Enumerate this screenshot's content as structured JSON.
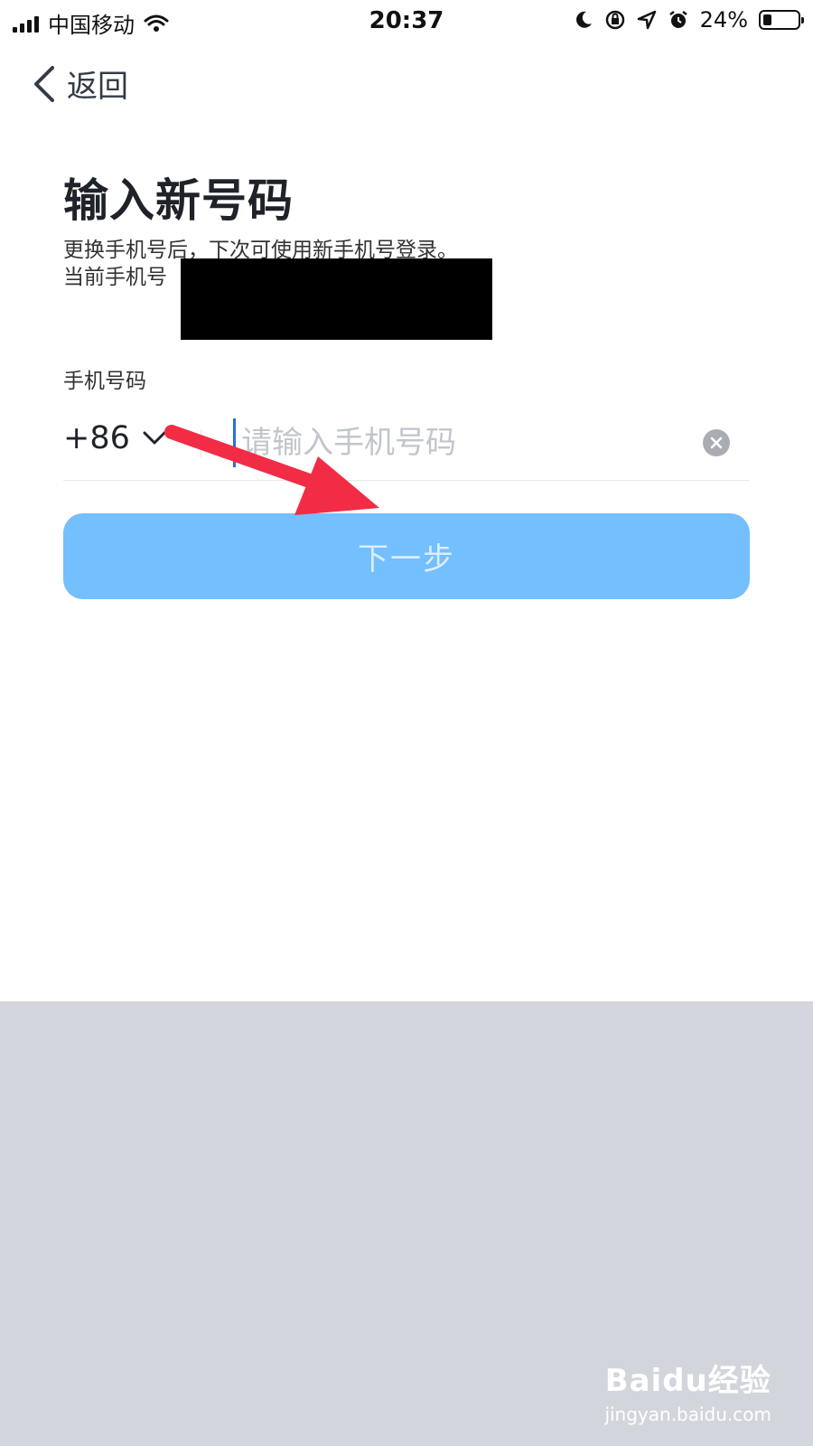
{
  "status_bar": {
    "carrier": "中国移动",
    "time": "20:37",
    "battery_percent": "24%",
    "battery_level": 0.24
  },
  "nav": {
    "back_label": "返回"
  },
  "page": {
    "title": "输入新号码",
    "description_line1": "更换手机号后，下次可使用新手机号登录。",
    "description_line2": "当前手机号"
  },
  "form": {
    "field_label": "手机号码",
    "country_code": "+86",
    "phone_value": "",
    "phone_placeholder": "请输入手机号码",
    "next_button": "下一步"
  },
  "watermark": {
    "brand": "Baidu经验",
    "url": "jingyan.baidu.com"
  },
  "colors": {
    "next_button_bg": "#74bffd",
    "annotation_arrow": "#f22c45",
    "keyboard_area": "#d2d5dc"
  }
}
